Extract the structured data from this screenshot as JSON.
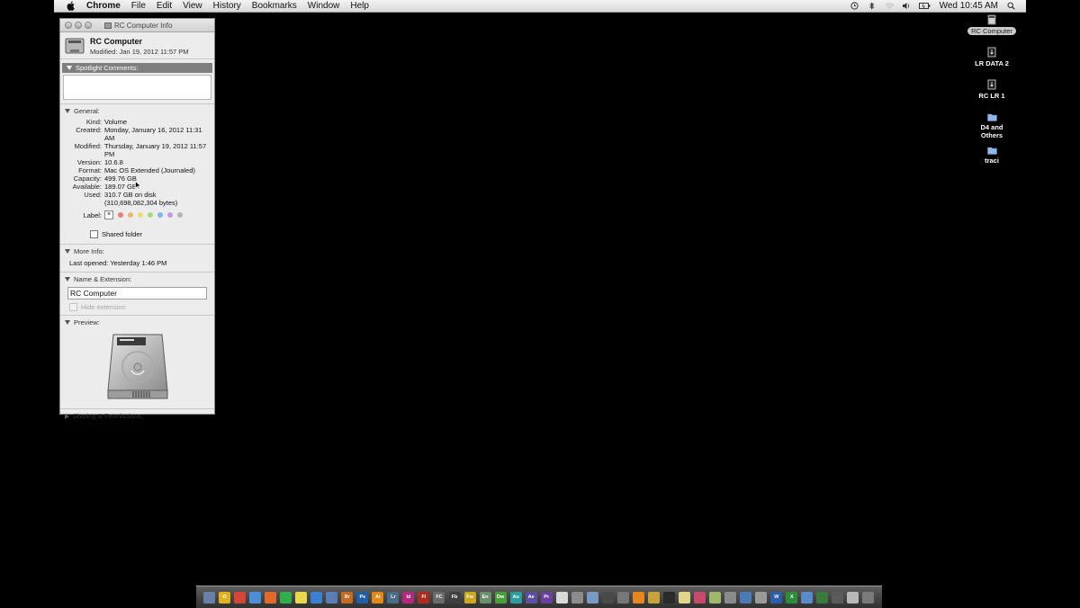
{
  "menubar": {
    "app_name": "Chrome",
    "items": [
      "File",
      "Edit",
      "View",
      "History",
      "Bookmarks",
      "Window",
      "Help"
    ],
    "clock": "Wed 10:45 AM"
  },
  "info_window": {
    "title": "RC Computer Info",
    "name": "RC Computer",
    "modified": "Modified: Jan 19, 2012 11:57 PM",
    "spotlight_label": "Spotlight Comments:",
    "general_label": "General:",
    "general": [
      {
        "k": "Kind:",
        "v": "Volume"
      },
      {
        "k": "Created:",
        "v": "Monday, January 16, 2012 11:31 AM"
      },
      {
        "k": "Modified:",
        "v": "Thursday, January 19, 2012 11:57 PM"
      },
      {
        "k": "Version:",
        "v": "10.6.8"
      },
      {
        "k": "Format:",
        "v": "Mac OS Extended (Journaled)"
      },
      {
        "k": "Capacity:",
        "v": "499.76 GB"
      },
      {
        "k": "Available:",
        "v": "189.07 GB"
      },
      {
        "k": "Used:",
        "v": "310.7 GB on disk (310,698,082,304 bytes)"
      }
    ],
    "label_key": "Label:",
    "label_box": "×",
    "label_colors": [
      "#e8504e",
      "#f0a23a",
      "#f1d33e",
      "#8fd14a",
      "#4aa3f0",
      "#b777e0",
      "#a0a0a0"
    ],
    "shared_folder": "Shared folder",
    "more_info_label": "More Info:",
    "last_opened": "Last opened: Yesterday 1:46 PM",
    "name_ext_label": "Name & Extension:",
    "name_field": "RC Computer",
    "hide_extension": "Hide extension",
    "preview_label": "Preview:",
    "sharing_label": "Sharing & Permissions:"
  },
  "desktop": [
    {
      "label": "RC Computer"
    },
    {
      "label": "LR DATA 2"
    },
    {
      "label": "RC LR 1"
    },
    {
      "label": "D4 and Others"
    },
    {
      "label": "traci"
    }
  ],
  "dock": [
    {
      "t": "",
      "c": "#6a7fa8"
    },
    {
      "t": "O",
      "c": "#e2b21c"
    },
    {
      "t": "",
      "c": "#d64535"
    },
    {
      "t": "",
      "c": "#4a8fd8"
    },
    {
      "t": "",
      "c": "#e36a2a"
    },
    {
      "t": "",
      "c": "#2fae49"
    },
    {
      "t": "",
      "c": "#e8d84a"
    },
    {
      "t": "",
      "c": "#3a7fd1"
    },
    {
      "t": "",
      "c": "#5b7db5"
    },
    {
      "t": "Br",
      "c": "#c56a1e"
    },
    {
      "t": "Ps",
      "c": "#1f5fa8"
    },
    {
      "t": "Ai",
      "c": "#e08a14"
    },
    {
      "t": "Lr",
      "c": "#4c6a8a"
    },
    {
      "t": "Id",
      "c": "#b5287d"
    },
    {
      "t": "Fl",
      "c": "#b02a1e"
    },
    {
      "t": "FC",
      "c": "#6a6a6a"
    },
    {
      "t": "Fb",
      "c": "#3f3f3f"
    },
    {
      "t": "Fw",
      "c": "#cfa71c"
    },
    {
      "t": "En",
      "c": "#6a8f6a"
    },
    {
      "t": "Dw",
      "c": "#4a9e3a"
    },
    {
      "t": "Au",
      "c": "#2a9e9e"
    },
    {
      "t": "Ae",
      "c": "#5a4fa0"
    },
    {
      "t": "Pr",
      "c": "#6a3fa0"
    },
    {
      "t": "",
      "c": "#d9d9d9"
    },
    {
      "t": "",
      "c": "#8c8c8c"
    },
    {
      "t": "",
      "c": "#7a98c4"
    },
    {
      "t": "",
      "c": "#4a4a4a"
    },
    {
      "t": "",
      "c": "#777"
    },
    {
      "t": "",
      "c": "#e8861e"
    },
    {
      "t": "",
      "c": "#c9a23a"
    },
    {
      "t": "",
      "c": "#2a2a2a"
    },
    {
      "t": "",
      "c": "#e0d68a"
    },
    {
      "t": "",
      "c": "#c84a6a"
    },
    {
      "t": "",
      "c": "#a0b86a"
    },
    {
      "t": "",
      "c": "#8a8a8a"
    },
    {
      "t": "",
      "c": "#4a7ab8"
    },
    {
      "t": "",
      "c": "#9a9a9a"
    },
    {
      "t": "W",
      "c": "#2a5fb0"
    },
    {
      "t": "X",
      "c": "#2a8f3a"
    },
    {
      "t": "",
      "c": "#5a8ac8"
    },
    {
      "t": "",
      "c": "#3a7a3a"
    },
    {
      "t": "",
      "c": "#5a5a5a"
    },
    {
      "t": "",
      "c": "#b8b8b8"
    },
    {
      "t": "",
      "c": "#7a7a7a"
    }
  ]
}
